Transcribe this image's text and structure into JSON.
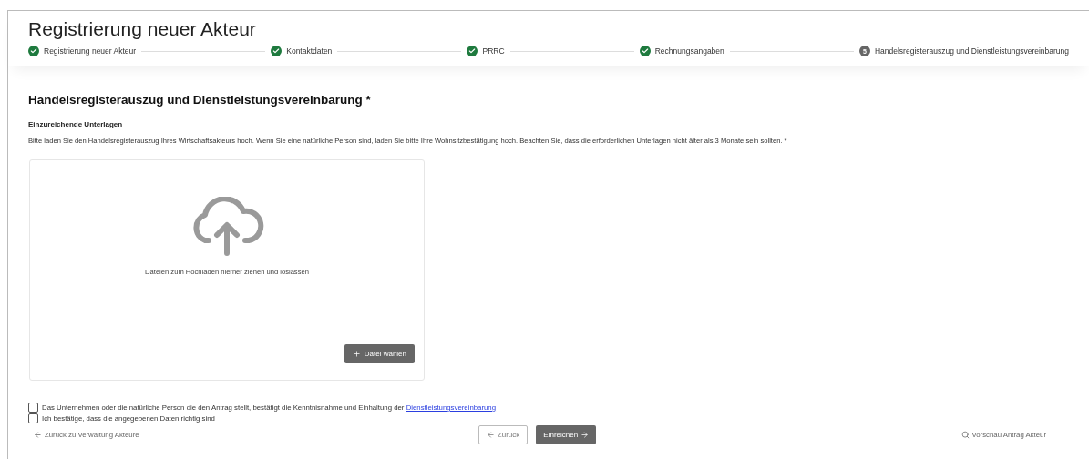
{
  "page_title": "Registrierung neuer Akteur",
  "steps": [
    {
      "label": "Registrierung neuer Akteur",
      "done": true
    },
    {
      "label": "Kontaktdaten",
      "done": true
    },
    {
      "label": "PRRC",
      "done": true
    },
    {
      "label": "Rechnungsangaben",
      "done": true
    },
    {
      "label": "Handelsregisterauszug und Dienstleistungsvereinbarung",
      "done": false,
      "number": "5"
    }
  ],
  "section_title": "Handelsregisterauszug und Dienstleistungsvereinbarung *",
  "documents_label": "Einzureichende Unterlagen",
  "documents_text": "Bitte laden Sie den Handelsregisterauszug Ihres Wirtschaftsakteurs hoch. Wenn Sie eine natürliche Person sind, laden Sie bitte Ihre Wohnsitzbestätigung hoch. Beachten Sie, dass die erforderlichen Unterlagen nicht älter als 3 Monate sein sollten. *",
  "dropzone": {
    "hint": "Dateien zum Hochladen hierher ziehen und loslassen",
    "button": "Datei wählen"
  },
  "checkboxes": [
    {
      "label": "Das Unternehmen oder die natürliche Person die den Antrag stellt, bestätigt die Kenntnisnahme und Einhaltung der",
      "link": "Dienstleistungsvereinbarung",
      "checked": false
    },
    {
      "label": "Ich bestätige, dass die angegebenen Daten richtig sind",
      "checked": false
    }
  ],
  "footer": {
    "back_link": "Zurück zu Verwaltung Akteure",
    "back_button": "Zurück",
    "submit_button": "Einreichen",
    "preview_link": "Vorschau Antrag Akteur"
  }
}
